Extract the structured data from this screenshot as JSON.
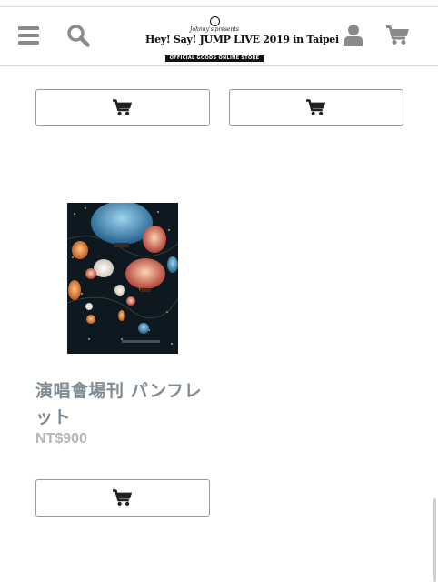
{
  "header": {
    "menu_icon": "menu-icon",
    "search_icon": "search-icon",
    "account_icon": "user-icon",
    "cart_icon": "cart-icon",
    "logo": {
      "presents": "Johnny's presents",
      "title": "Hey! Say! JUMP LIVE 2019 in Taipei",
      "subtitle": "OFFICIAL GOODS ONLINE STORE"
    }
  },
  "products": [
    {
      "name": "",
      "price": "",
      "add_to_cart_icon": "cart-icon"
    },
    {
      "name": "",
      "price": "",
      "add_to_cart_icon": "cart-icon"
    },
    {
      "name": "演唱會場刊 パンフレット",
      "price": "NT$900",
      "add_to_cart_icon": "cart-icon"
    }
  ],
  "colors": {
    "icon_gray": "#8a8a8a",
    "product_name": "#7e8a92",
    "price": "#b0b5b8",
    "button_border": "#9a9a9a",
    "cart_glyph": "#222222"
  }
}
